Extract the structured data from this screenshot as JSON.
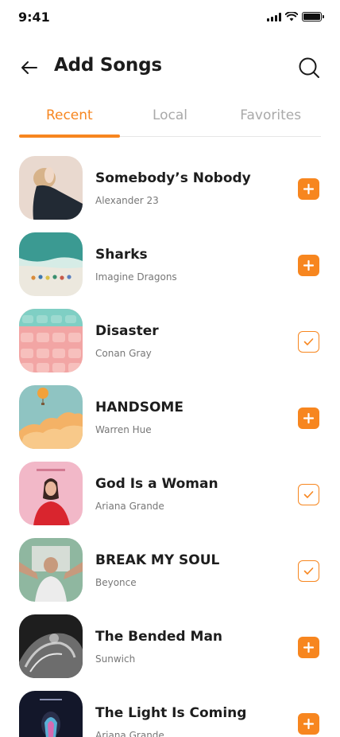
{
  "status_bar": {
    "time": "9:41"
  },
  "header": {
    "title": "Add Songs"
  },
  "tabs": [
    {
      "label": "Recent",
      "active": true
    },
    {
      "label": "Local",
      "active": false
    },
    {
      "label": "Favorites",
      "active": false
    }
  ],
  "songs": [
    {
      "title": "Somebody’s Nobody",
      "artist": "Alexander 23",
      "added": false
    },
    {
      "title": "Sharks",
      "artist": "Imagine Dragons",
      "added": false
    },
    {
      "title": "Disaster",
      "artist": "Conan Gray",
      "added": true
    },
    {
      "title": "HANDSOME",
      "artist": "Warren Hue",
      "added": false
    },
    {
      "title": "God Is a Woman",
      "artist": "Ariana Grande",
      "added": true
    },
    {
      "title": "BREAK MY SOUL",
      "artist": "Beyonce",
      "added": true
    },
    {
      "title": "The Bended Man",
      "artist": "Sunwich",
      "added": false
    },
    {
      "title": "The Light Is Coming",
      "artist": "Ariana Grande",
      "added": false
    }
  ],
  "colors": {
    "accent": "#f7861f",
    "text": "#1d1d1d",
    "muted": "#a9a9a9"
  }
}
